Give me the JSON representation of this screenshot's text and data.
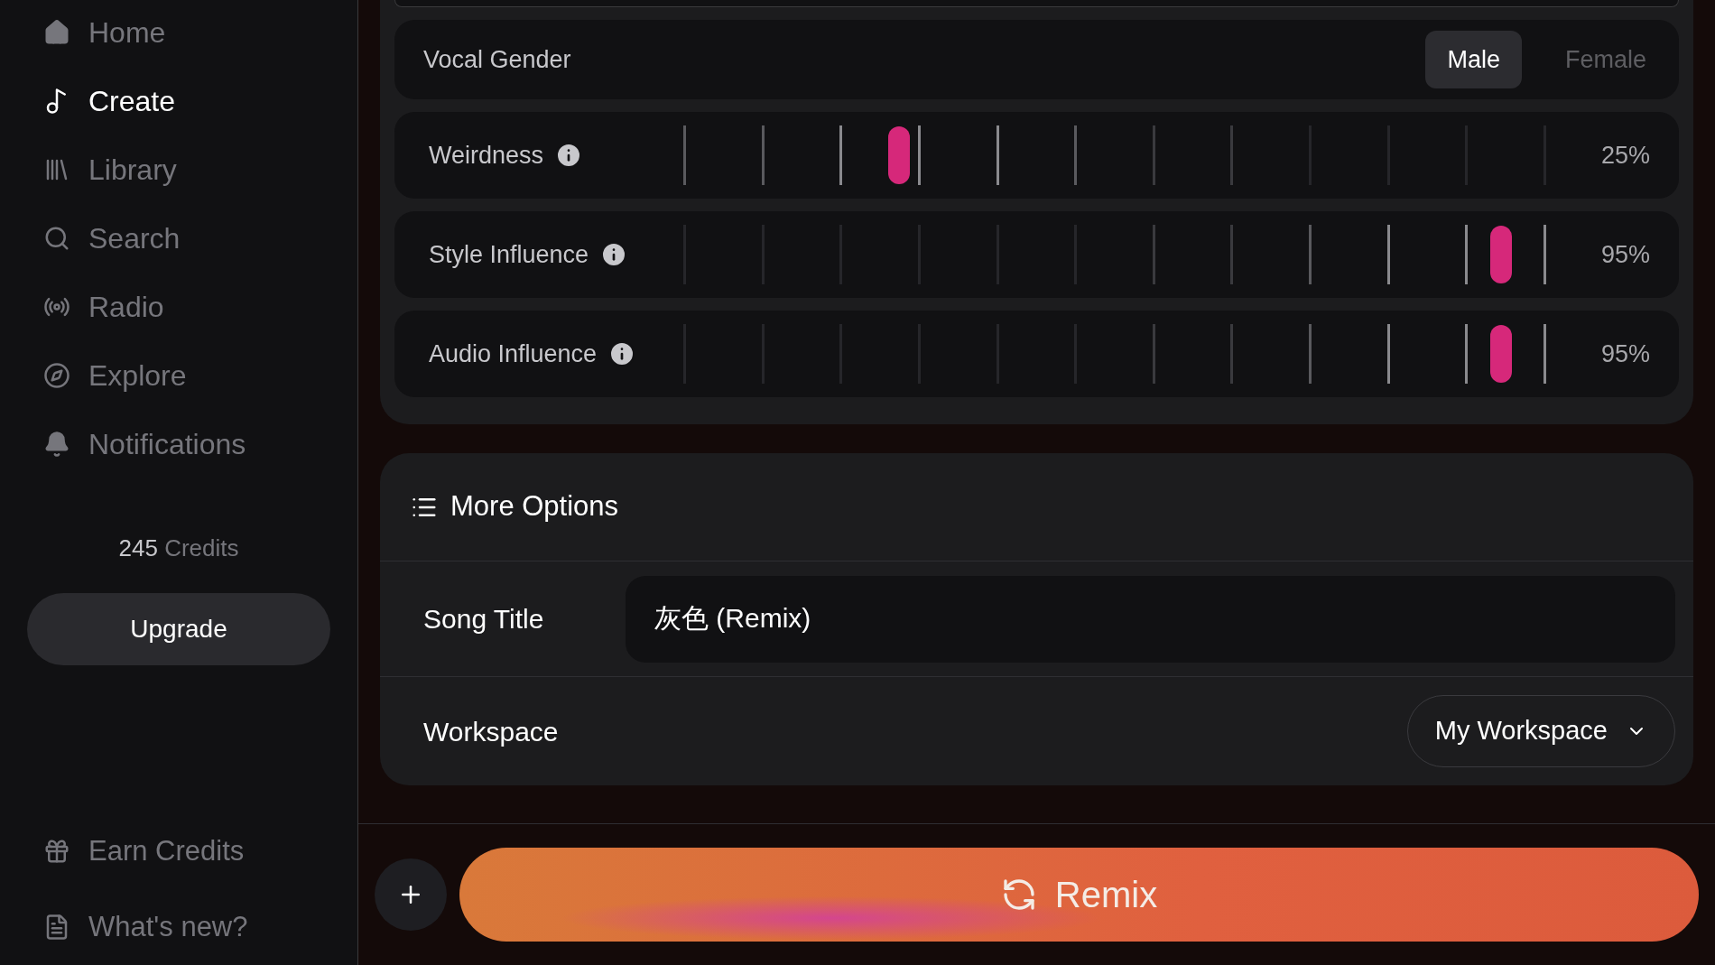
{
  "sidebar": {
    "items": [
      {
        "label": "Home",
        "selected": false
      },
      {
        "label": "Create",
        "selected": true
      },
      {
        "label": "Library",
        "selected": false
      },
      {
        "label": "Search",
        "selected": false
      },
      {
        "label": "Radio",
        "selected": false
      },
      {
        "label": "Explore",
        "selected": false
      },
      {
        "label": "Notifications",
        "selected": false
      }
    ],
    "credits": {
      "count": "245",
      "label": "Credits"
    },
    "upgrade_button": "Upgrade",
    "footer_items": [
      {
        "label": "Earn Credits"
      },
      {
        "label": "What's new?"
      }
    ]
  },
  "vocal_gender": {
    "label": "Vocal Gender",
    "options": [
      {
        "label": "Male",
        "selected": true
      },
      {
        "label": "Female",
        "selected": false
      }
    ]
  },
  "sliders": [
    {
      "label": "Weirdness",
      "level": 0.25,
      "reading": "25%"
    },
    {
      "label": "Style Influence",
      "level": 0.95,
      "reading": "95%"
    },
    {
      "label": "Audio Influence",
      "level": 0.95,
      "reading": "95%"
    }
  ],
  "more_options": {
    "title": "More Options",
    "song_title": {
      "label": "Song Title",
      "value": "灰色 (Remix)"
    },
    "workspace": {
      "label": "Workspace",
      "value": "My Workspace"
    }
  },
  "remix_button": "Remix"
}
